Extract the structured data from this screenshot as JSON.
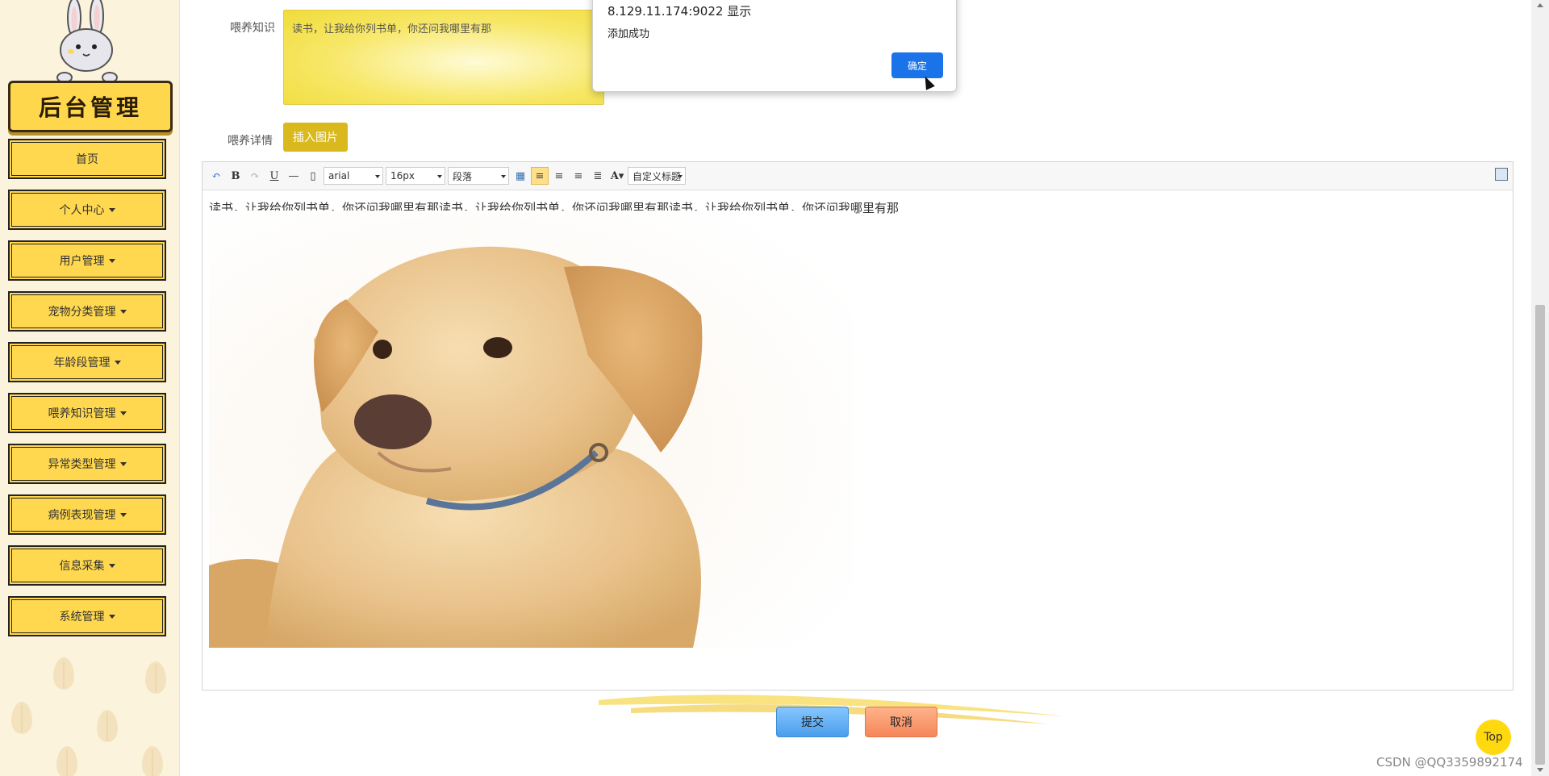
{
  "sidebar": {
    "logo_text": "后台管理",
    "items": [
      {
        "label": "首页",
        "has_caret": false
      },
      {
        "label": "个人中心",
        "has_caret": true
      },
      {
        "label": "用户管理",
        "has_caret": true
      },
      {
        "label": "宠物分类管理",
        "has_caret": true
      },
      {
        "label": "年龄段管理",
        "has_caret": true
      },
      {
        "label": "喂养知识管理",
        "has_caret": true
      },
      {
        "label": "异常类型管理",
        "has_caret": true
      },
      {
        "label": "病例表现管理",
        "has_caret": true
      },
      {
        "label": "信息采集",
        "has_caret": true
      },
      {
        "label": "系统管理",
        "has_caret": true
      }
    ]
  },
  "form": {
    "knowledge_label": "喂养知识",
    "knowledge_value": "读书，让我给你列书单，你还问我哪里有那",
    "details_label": "喂养详情",
    "insert_image_label": "插入图片"
  },
  "editor": {
    "font_family": "arial",
    "font_size": "16px",
    "paragraph": "段落",
    "custom_title": "自定义标题",
    "content_text": "读书，让我给你列书单，你还问我哪里有那读书，让我给你列书单，你还问我哪里有那读书，让我给你列书单，你还问我哪里有那"
  },
  "actions": {
    "submit_label": "提交",
    "cancel_label": "取消",
    "top_label": "Top"
  },
  "dialog": {
    "origin": "8.129.11.174:9022 显示",
    "message": "添加成功",
    "ok_label": "确定"
  },
  "watermark": "CSDN @QQ3359892174",
  "colors": {
    "sidebar_item_bg": "#ffd84f",
    "accent_blue": "#1a73e8",
    "insert_button": "#d9b91d"
  }
}
